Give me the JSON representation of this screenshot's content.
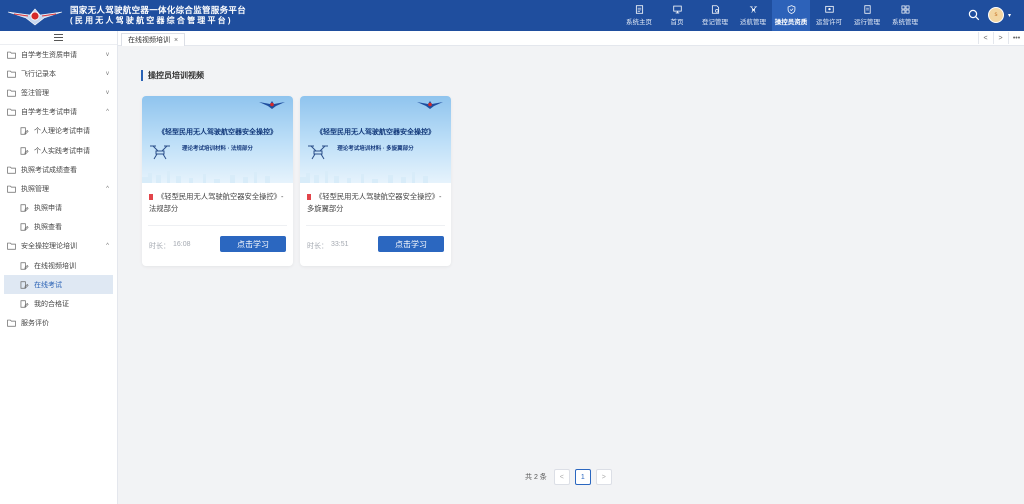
{
  "header": {
    "title_line1": "国家无人驾驶航空器一体化综合监管服务平台",
    "title_line2": "(民用无人驾驶航空器综合管理平台)",
    "nav": [
      {
        "label": "系统主页",
        "icon": "monitor-doc-icon",
        "active": false
      },
      {
        "label": "首页",
        "icon": "desktop-icon",
        "active": false
      },
      {
        "label": "登记管理",
        "icon": "register-doc-icon",
        "active": false
      },
      {
        "label": "适航管理",
        "icon": "drone-icon",
        "active": false
      },
      {
        "label": "操控员资质",
        "icon": "shield-icon",
        "active": true
      },
      {
        "label": "运营许可",
        "icon": "certificate-icon",
        "active": false
      },
      {
        "label": "运行管理",
        "icon": "file-list-icon",
        "active": false
      },
      {
        "label": "系统管理",
        "icon": "settings-grid-icon",
        "active": false
      }
    ],
    "avatar_text": "s"
  },
  "sidebar": {
    "items": [
      {
        "label": "自学考生资质申请",
        "level": 1,
        "chevron": "v"
      },
      {
        "label": "飞行记录本",
        "level": 1,
        "chevron": "v"
      },
      {
        "label": "签注管理",
        "level": 1,
        "chevron": "v"
      },
      {
        "label": "自学考生考试申请",
        "level": 1,
        "chevron": "^"
      },
      {
        "label": "个人理论考试申请",
        "level": 2
      },
      {
        "label": "个人实践考试申请",
        "level": 2
      },
      {
        "label": "执照考试成绩查看",
        "level": 1
      },
      {
        "label": "执照管理",
        "level": 1,
        "chevron": "^"
      },
      {
        "label": "执照申请",
        "level": 2
      },
      {
        "label": "执照查看",
        "level": 2
      },
      {
        "label": "安全操控理论培训",
        "level": 1,
        "chevron": "^"
      },
      {
        "label": "在线视频培训",
        "level": 2
      },
      {
        "label": "在线考试",
        "level": 2,
        "active": true
      },
      {
        "label": "我的合格证",
        "level": 2
      },
      {
        "label": "服务评价",
        "level": 1
      }
    ]
  },
  "tabs": {
    "active_label": "在线视频培训",
    "close": "×",
    "prev": "<",
    "next": ">",
    "more": "•••"
  },
  "main": {
    "section_title": "操控员培训视频",
    "cards": [
      {
        "cover_title": "《轻型民用无人驾驶航空器安全操控》",
        "cover_subtitle": "理论考试培训材料 · 法规部分",
        "title": "《轻型民用无人驾驶航空器安全操控》- 法规部分",
        "duration_label": "时长：",
        "duration": "16:08",
        "button": "点击学习"
      },
      {
        "cover_title": "《轻型民用无人驾驶航空器安全操控》",
        "cover_subtitle": "理论考试培训材料 · 多旋翼部分",
        "title": "《轻型民用无人驾驶航空器安全操控》- 多旋翼部分",
        "duration_label": "时长：",
        "duration": "33:51",
        "button": "点击学习"
      }
    ]
  },
  "pagination": {
    "total_text": "共 2 条",
    "current_page": "1",
    "prev": "<",
    "next": ">"
  },
  "colors": {
    "header_bg": "#1f4e9e",
    "accent": "#2b67c0",
    "active_menu_bg": "#dfe8f3"
  }
}
